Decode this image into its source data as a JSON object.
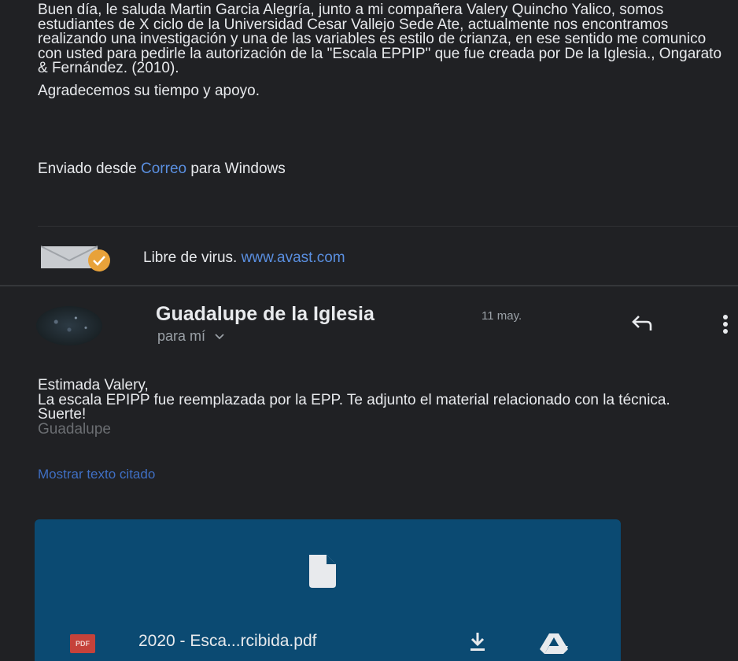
{
  "previous_message": {
    "paragraph1": "Buen día, le saluda Martin Garcia Alegría, junto a mi compañera Valery Quincho Yalico, somos estudiantes de X ciclo de la Universidad Cesar Vallejo Sede Ate, actualmente nos encontramos realizando una investigación y una de las variables es estilo de crianza, en ese sentido me comunico con usted para pedirle la autorización de la \"Escala EPPIP\" que fue creada por De la Iglesia., Ongarato & Fernández. (2010).",
    "paragraph2": "Agradecemos su tiempo y apoyo.",
    "sent_from_prefix": "Enviado desde ",
    "sent_from_link": "Correo",
    "sent_from_suffix": " para Windows",
    "virus_text": "Libre de virus. ",
    "virus_link": "www.avast.com"
  },
  "reply": {
    "sender_name": "Guadalupe de la Iglesia",
    "date": "11 may.",
    "to_label": "para mí",
    "greeting": "Estimada Valery,",
    "body_line1": "La escala EPIPP fue reemplazada por la EPP. Te adjunto el material relacionado con la técnica.",
    "closing": "Suerte!",
    "signature": "Guadalupe",
    "show_quoted": "Mostrar texto citado"
  },
  "attachment": {
    "type_badge": "PDF",
    "filename": "2020 - Esca...rcibida.pdf",
    "background_color": "#0b4a72"
  },
  "icons": {
    "reply": "reply-arrow-icon",
    "more": "more-vert-icon",
    "download": "download-icon",
    "drive": "google-drive-icon",
    "document": "document-icon"
  },
  "colors": {
    "background": "#202124",
    "link": "#5a8fe0",
    "muted": "#9aa0a6"
  }
}
